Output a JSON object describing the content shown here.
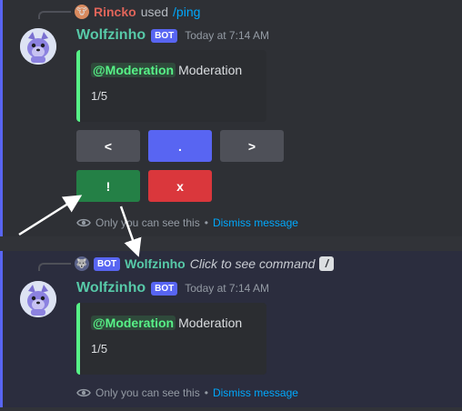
{
  "message1": {
    "reply": {
      "user": "Rincko",
      "verb": "used",
      "command": "/ping"
    },
    "author": "Wolfzinho",
    "bot_tag": "BOT",
    "timestamp": "Today at 7:14 AM",
    "embed": {
      "mention": "@Moderation",
      "title": "Moderation",
      "description": "1/5",
      "accent_color": "#57f287"
    },
    "buttons_row1": [
      {
        "label": "<",
        "style": "secondary"
      },
      {
        "label": ".",
        "style": "primary"
      },
      {
        "label": ">",
        "style": "secondary"
      }
    ],
    "buttons_row2": [
      {
        "label": "!",
        "style": "success"
      },
      {
        "label": "x",
        "style": "danger"
      }
    ],
    "ephemeral": {
      "text": "Only you can see this",
      "separator": "•",
      "dismiss": "Dismiss message"
    }
  },
  "message2": {
    "reply": {
      "bot_tag": "BOT",
      "user": "Wolfzinho",
      "hint": "Click to see command"
    },
    "author": "Wolfzinho",
    "bot_tag": "BOT",
    "timestamp": "Today at 7:14 AM",
    "embed": {
      "mention": "@Moderation",
      "title": "Moderation",
      "description": "1/5",
      "accent_color": "#57f287"
    },
    "ephemeral": {
      "text": "Only you can see this",
      "separator": "•",
      "dismiss": "Dismiss message"
    }
  },
  "colors": {
    "background": "#313338",
    "blurple": "#5865f2",
    "username": "#57c9a8",
    "link": "#00a8fc",
    "success": "#248046",
    "danger": "#da373c"
  }
}
